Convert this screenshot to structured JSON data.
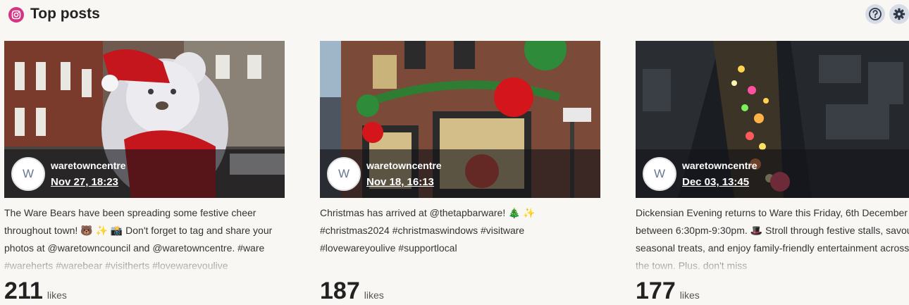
{
  "header": {
    "title": "Top posts",
    "brand_color": "#d63384",
    "icons": [
      "instagram-icon",
      "help-icon",
      "settings-icon"
    ]
  },
  "posts": [
    {
      "username": "waretowncentre",
      "avatar_letter": "W",
      "date": "Nov 27, 18:23",
      "caption": "The Ware Bears have been spreading some festive cheer throughout town! 🐻 ✨ 📸 Don't forget to tag and share your photos at @waretowncouncil and @waretowncentre. #ware #wareherts #warebear #visitherts #lovewareyoulive",
      "likes": "211",
      "likes_label": "likes"
    },
    {
      "username": "waretowncentre",
      "avatar_letter": "W",
      "date": "Nov 18, 16:13",
      "caption": "Christmas has arrived at @thetapbarware! 🎄 ✨ #christmas2024 #christmaswindows #visitware #lovewareyoulive #supportlocal",
      "likes": "187",
      "likes_label": "likes"
    },
    {
      "username": "waretowncentre",
      "avatar_letter": "W",
      "date": "Dec 03, 13:45",
      "caption": "Dickensian Evening returns to Ware this Friday, 6th December between 6:30pm-9:30pm. 🎩 Stroll through festive stalls, savour seasonal treats, and enjoy family-friendly entertainment across the town. Plus, don't miss",
      "likes": "177",
      "likes_label": "likes"
    }
  ]
}
